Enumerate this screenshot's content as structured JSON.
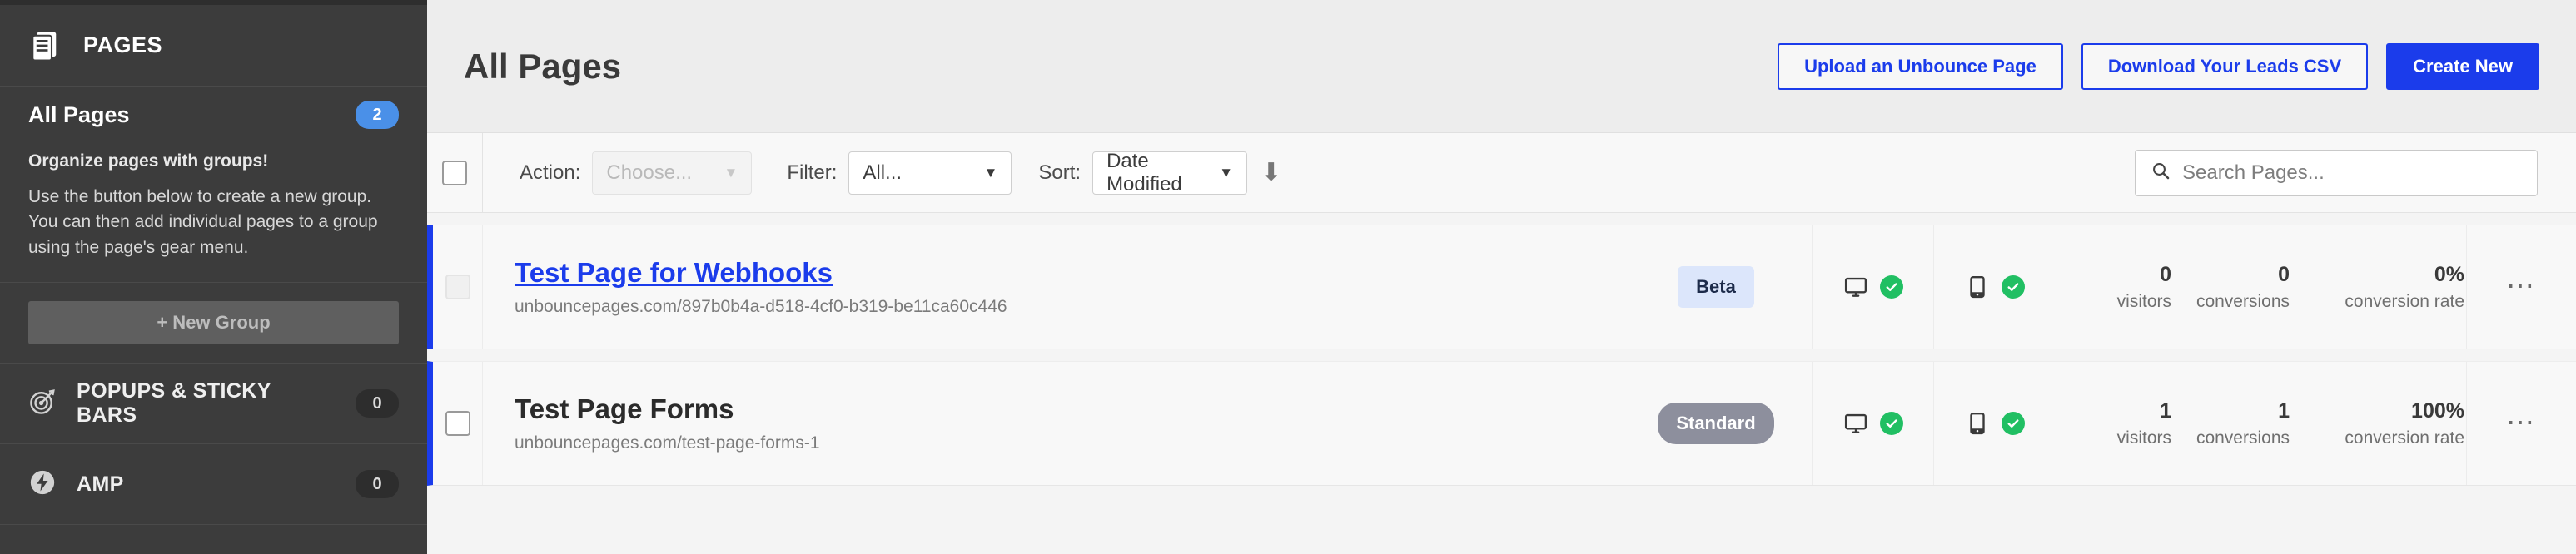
{
  "sidebar": {
    "header": {
      "label": "PAGES",
      "icon": "pages-icon"
    },
    "all_pages": {
      "label": "All Pages",
      "count": "2"
    },
    "promo": {
      "heading": "Organize pages with groups!",
      "body": "Use the button below to create a new group. You can then add individual pages to a group using the page's gear menu."
    },
    "new_group_button": "+ New Group",
    "items": [
      {
        "label": "POPUPS & STICKY BARS",
        "count": "0",
        "icon": "target-icon"
      },
      {
        "label": "AMP",
        "count": "0",
        "icon": "lightning-bolt-icon"
      }
    ]
  },
  "header": {
    "title": "All Pages",
    "buttons": [
      {
        "label": "Upload an Unbounce Page",
        "style": "outline"
      },
      {
        "label": "Download Your Leads CSV",
        "style": "outline"
      },
      {
        "label": "Create New",
        "style": "primary"
      }
    ]
  },
  "toolbar": {
    "action_label": "Action:",
    "action_value": "Choose...",
    "filter_label": "Filter:",
    "filter_value": "All...",
    "sort_label": "Sort:",
    "sort_value": "Date Modified",
    "sort_direction_icon": "arrow-down-icon",
    "search_placeholder": "Search Pages...",
    "search_value": ""
  },
  "colors": {
    "accent_blue": "#1b3ceb",
    "badge_blue": "#4a90e8",
    "status_green": "#21bf63",
    "sidebar_bg": "#3c3c3c",
    "beta_tag_bg": "#dce6fb",
    "standard_tag_bg": "#8d8f9d"
  },
  "stat_labels": {
    "visitors": "visitors",
    "conversions": "conversions",
    "conversion_rate": "conversion rate"
  },
  "rows": [
    {
      "title": "Test Page for Webhooks",
      "title_is_link": true,
      "url": "unbouncepages.com/897b0b4a-d518-4cf0-b319-be11ca60c446",
      "tag": "Beta",
      "tag_style": "beta",
      "desktop_status": "ok",
      "mobile_status": "ok",
      "visitors": "0",
      "conversions": "0",
      "conversion_rate": "0%"
    },
    {
      "title": "Test Page Forms",
      "title_is_link": false,
      "url": "unbouncepages.com/test-page-forms-1",
      "tag": "Standard",
      "tag_style": "standard",
      "desktop_status": "ok",
      "mobile_status": "ok",
      "visitors": "1",
      "conversions": "1",
      "conversion_rate": "100%"
    }
  ]
}
